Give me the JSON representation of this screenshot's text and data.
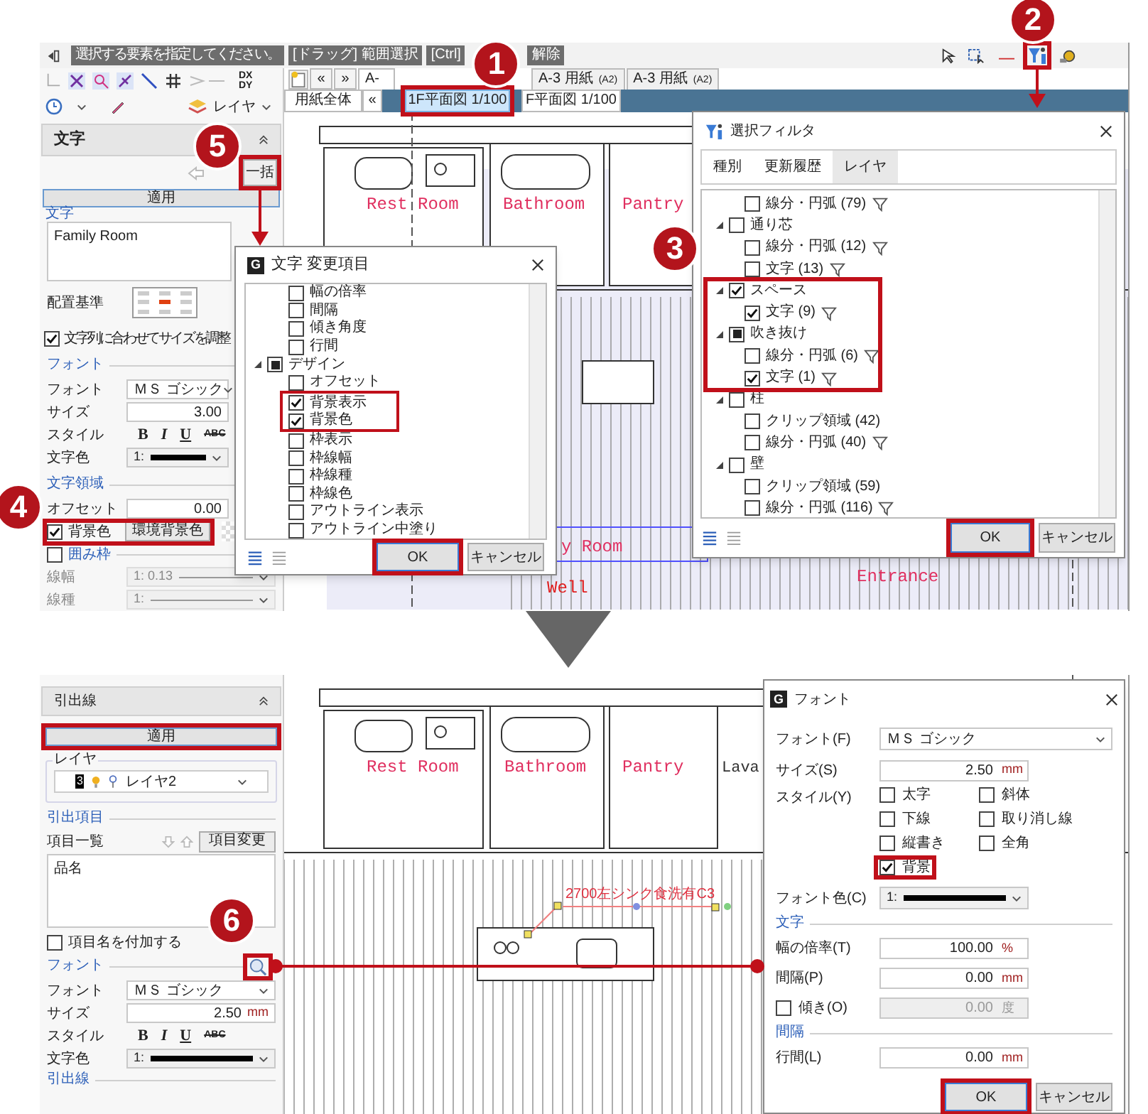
{
  "top_screen": {
    "prompts": [
      "選択する要素を指定してください。",
      "[ドラッグ] 範囲選択",
      "[Ctrl]",
      "解除"
    ],
    "dxdy": [
      "DX",
      "DY"
    ],
    "layer_button": "レイヤ",
    "sheet_tabs": [
      {
        "label": "A-",
        "selected": true
      },
      {
        "label": "A-3 用紙",
        "size": "(A2)",
        "selected": false
      },
      {
        "label": "A-3 用紙",
        "size": "(A2)",
        "selected": false
      }
    ],
    "tab_nav": [
      "«",
      "»"
    ],
    "view_tabs": [
      {
        "label": "用紙全体",
        "selected": false
      },
      {
        "label": "«",
        "selected": false
      },
      {
        "label": "1F平面図 1/100",
        "selected": true
      },
      {
        "label": "F平面図 1/100",
        "selected": false
      }
    ],
    "panel": {
      "title": "文字",
      "batch_button": "一括",
      "apply_button": "適用",
      "text_group": "文字",
      "text_value": "Family Room",
      "align_label": "配置基準",
      "fit_checkbox": {
        "label": "文字列に合わせてサイズを調整",
        "checked": true
      },
      "font_section": "フォント",
      "font_rows": [
        {
          "label": "フォント",
          "kind": "select",
          "value": "ＭＳ ゴシック"
        },
        {
          "label": "サイズ",
          "kind": "number",
          "value": "3.00"
        },
        {
          "label": "スタイル",
          "kind": "style"
        },
        {
          "label": "文字色",
          "kind": "color",
          "value": "1:"
        }
      ],
      "style_buttons": [
        "B",
        "I",
        "U",
        "ABC"
      ],
      "area_section": "文字領域",
      "offset": {
        "label": "オフセット",
        "value": "0.00"
      },
      "background": {
        "label": "背景色",
        "checked": true,
        "button": "環境背景色"
      },
      "frame": {
        "label": "囲み枠",
        "checked": false
      },
      "frame_rows": [
        {
          "label": "線幅",
          "value": "1: 0.13"
        },
        {
          "label": "線種",
          "value": "1:"
        }
      ]
    },
    "plan_labels": [
      "Rest Room",
      "Bathroom",
      "Pantry",
      "y Room",
      "Well",
      "Entrance"
    ],
    "change_dialog": {
      "icon_letter": "G",
      "title": "文字 変更項目",
      "items": [
        {
          "kind": "leaf",
          "label": "幅の倍率",
          "checked": false,
          "indeterminate": false
        },
        {
          "kind": "leaf",
          "label": "間隔",
          "checked": false,
          "indeterminate": false
        },
        {
          "kind": "leaf",
          "label": "傾き角度",
          "checked": false,
          "indeterminate": false
        },
        {
          "kind": "leaf",
          "label": "行間",
          "checked": false,
          "indeterminate": false
        },
        {
          "kind": "group",
          "label": "デザイン",
          "checked": false,
          "indeterminate": true,
          "children": [
            {
              "label": "オフセット",
              "checked": false,
              "indeterminate": false
            },
            {
              "label": "背景表示",
              "checked": true,
              "indeterminate": false
            },
            {
              "label": "背景色",
              "checked": true,
              "indeterminate": false
            },
            {
              "label": "枠表示",
              "checked": false,
              "indeterminate": false
            },
            {
              "label": "枠線幅",
              "checked": false,
              "indeterminate": false
            },
            {
              "label": "枠線種",
              "checked": false,
              "indeterminate": false
            },
            {
              "label": "枠線色",
              "checked": false,
              "indeterminate": false
            },
            {
              "label": "アウトライン表示",
              "checked": false,
              "indeterminate": false
            },
            {
              "label": "アウトライン中塗り",
              "checked": false,
              "indeterminate": false
            }
          ]
        }
      ],
      "ok": "OK",
      "cancel": "キャンセル"
    },
    "filter_dialog": {
      "title": "選択フィルタ",
      "tabs": [
        {
          "label": "種別",
          "selected": false
        },
        {
          "label": "更新履歴",
          "selected": false
        },
        {
          "label": "レイヤ",
          "selected": true
        }
      ],
      "tree": [
        {
          "kind": "leaf",
          "label": "線分・円弧 (79)",
          "checked": false,
          "indeterminate": false,
          "filter_icon": true
        },
        {
          "kind": "group",
          "label": "通り芯",
          "checked": false,
          "indeterminate": false,
          "children": [
            {
              "label": "線分・円弧 (12)",
              "checked": false,
              "indeterminate": false,
              "filter_icon": true
            },
            {
              "label": "文字 (13)",
              "checked": false,
              "indeterminate": false,
              "filter_icon": true
            }
          ]
        },
        {
          "kind": "group",
          "label": "スペース",
          "checked": true,
          "indeterminate": false,
          "children": [
            {
              "label": "文字 (9)",
              "checked": true,
              "indeterminate": false,
              "filter_icon": true
            }
          ]
        },
        {
          "kind": "group",
          "label": "吹き抜け",
          "checked": false,
          "indeterminate": true,
          "children": [
            {
              "label": "線分・円弧 (6)",
              "checked": false,
              "indeterminate": false,
              "filter_icon": true
            },
            {
              "label": "文字 (1)",
              "checked": true,
              "indeterminate": false,
              "filter_icon": true
            }
          ]
        },
        {
          "kind": "group",
          "label": "柱",
          "checked": false,
          "indeterminate": false,
          "children": [
            {
              "label": "クリップ領域 (42)",
              "checked": false,
              "indeterminate": false,
              "filter_icon": false
            },
            {
              "label": "線分・円弧 (40)",
              "checked": false,
              "indeterminate": false,
              "filter_icon": true
            }
          ]
        },
        {
          "kind": "group",
          "label": "壁",
          "checked": false,
          "indeterminate": false,
          "children": [
            {
              "label": "クリップ領域 (59)",
              "checked": false,
              "indeterminate": false,
              "filter_icon": false
            },
            {
              "label": "線分・円弧 (116)",
              "checked": false,
              "indeterminate": false,
              "filter_icon": true
            }
          ]
        }
      ],
      "ok": "OK",
      "cancel": "キャンセル"
    }
  },
  "callouts": [
    "1",
    "2",
    "3",
    "4",
    "5",
    "6"
  ],
  "bottom_screen": {
    "panel": {
      "title": "引出線",
      "apply_button": "適用",
      "layer_group": "レイヤ",
      "layer_number": "3",
      "layer_name": "レイヤ2",
      "items_section": "引出項目",
      "items_label": "項目一覧",
      "change_button": "項目変更",
      "items": [
        "品名"
      ],
      "add_name": {
        "label": "項目名を付加する",
        "checked": false
      },
      "font_section": "フォント",
      "font_rows": [
        {
          "label": "フォント",
          "kind": "select",
          "value": "ＭＳ ゴシック"
        },
        {
          "label": "サイズ",
          "kind": "number",
          "value": "2.50",
          "unit": "mm"
        },
        {
          "label": "スタイル",
          "kind": "style"
        },
        {
          "label": "文字色",
          "kind": "color",
          "value": "1:"
        }
      ],
      "style_buttons": [
        "B",
        "I",
        "U",
        "ABC"
      ],
      "leader_section": "引出線"
    },
    "plan_labels": [
      "Rest Room",
      "Bathroom",
      "Pantry",
      "Lava"
    ],
    "leader_text": "2700左シンク食洗有C3",
    "font_dialog": {
      "icon_letter": "G",
      "title": "フォント",
      "font": {
        "label": "フォント(F)",
        "value": "ＭＳ ゴシック"
      },
      "size": {
        "label": "サイズ(S)",
        "value": "2.50",
        "unit": "mm"
      },
      "style_label": "スタイル(Y)",
      "styles": [
        {
          "label": "太字",
          "checked": false
        },
        {
          "label": "斜体",
          "checked": false
        },
        {
          "label": "下線",
          "checked": false
        },
        {
          "label": "取り消し線",
          "checked": false
        },
        {
          "label": "縦書き",
          "checked": false
        },
        {
          "label": "全角",
          "checked": false
        },
        {
          "label": "背景",
          "checked": true
        }
      ],
      "color": {
        "label": "フォント色(C)",
        "value": "1:"
      },
      "text_section": "文字",
      "rows": [
        {
          "kind": "field",
          "label": "幅の倍率(T)",
          "value": "100.00",
          "unit": "%"
        },
        {
          "kind": "field",
          "label": "間隔(P)",
          "value": "0.00",
          "unit": "mm"
        },
        {
          "kind": "check_field",
          "label": "傾き(O)",
          "value": "0.00",
          "unit": "度",
          "checked": false
        }
      ],
      "spacing_section": "間隔",
      "line_spacing": {
        "label": "行間(L)",
        "value": "0.00",
        "unit": "mm"
      },
      "ok": "OK",
      "cancel": "キャンセル"
    }
  }
}
